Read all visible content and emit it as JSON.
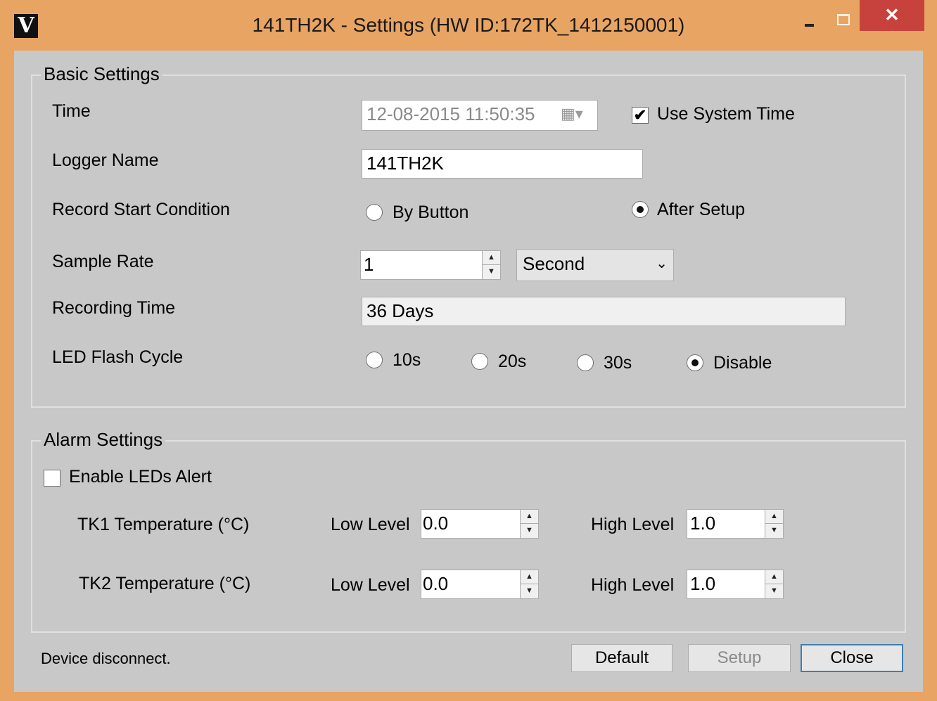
{
  "window": {
    "title": "141TH2K - Settings (HW ID:172TK_1412150001)",
    "app_icon_glyph": "V",
    "close_glyph": "✕"
  },
  "basic": {
    "group_title": "Basic Settings",
    "time_label": "Time",
    "time_value": "12-08-2015  11:50:35",
    "use_system_time_label": "Use System Time",
    "use_system_time_checked": true,
    "logger_name_label": "Logger Name",
    "logger_name_value": "141TH2K",
    "record_start_label": "Record Start Condition",
    "by_button_label": "By Button",
    "after_setup_label": "After Setup",
    "record_start_selected": "After Setup",
    "sample_rate_label": "Sample Rate",
    "sample_rate_value": "1",
    "sample_rate_unit": "Second",
    "recording_time_label": "Recording Time",
    "recording_time_value": "36 Days",
    "led_flash_label": "LED Flash Cycle",
    "led_options": [
      "10s",
      "20s",
      "30s",
      "Disable"
    ],
    "led_selected": "Disable"
  },
  "alarm": {
    "group_title": "Alarm Settings",
    "enable_leds_label": "Enable LEDs Alert",
    "enable_leds_checked": false,
    "low_level_label": "Low Level",
    "high_level_label": "High Level",
    "rows": [
      {
        "label": "TK1 Temperature (°C)",
        "low": "0.0",
        "high": "1.0"
      },
      {
        "label": "TK2 Temperature (°C)",
        "low": "0.0",
        "high": "1.0"
      }
    ]
  },
  "footer": {
    "status_text": "Device disconnect.",
    "default_label": "Default",
    "setup_label": "Setup",
    "close_label": "Close"
  },
  "icons": {
    "calendar": "calendar-icon",
    "spin_up": "▲",
    "spin_down": "▼",
    "dropdown": "⌄"
  },
  "colors": {
    "frame": "#e8a462",
    "close_button": "#c7423d",
    "client_bg": "#c8c8c8",
    "focus_border": "#3c7fb1"
  }
}
